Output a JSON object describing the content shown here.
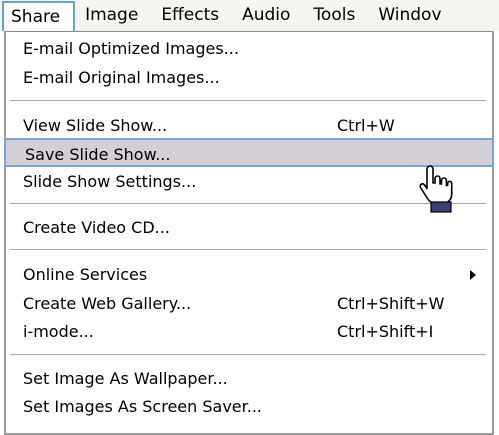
{
  "menubar": {
    "items": [
      "Share",
      "Image",
      "Effects",
      "Audio",
      "Tools",
      "Windov"
    ]
  },
  "menu": {
    "items": [
      {
        "label": "E-mail Optimized Images...",
        "shortcut": ""
      },
      {
        "label": "E-mail Original Images...",
        "shortcut": ""
      },
      {
        "label": "View Slide Show...",
        "shortcut": "Ctrl+W"
      },
      {
        "label": "Save Slide Show...",
        "shortcut": ""
      },
      {
        "label": "Slide Show Settings...",
        "shortcut": ""
      },
      {
        "label": "Create Video CD...",
        "shortcut": ""
      },
      {
        "label": "Online Services",
        "shortcut": ""
      },
      {
        "label": "Create Web Gallery...",
        "shortcut": "Ctrl+Shift+W"
      },
      {
        "label": "i-mode...",
        "shortcut": "Ctrl+Shift+I"
      },
      {
        "label": "Set Image As Wallpaper...",
        "shortcut": ""
      },
      {
        "label": "Set Images As Screen Saver...",
        "shortcut": ""
      }
    ]
  },
  "colors": {
    "highlight_bg": "#d4cfd6",
    "highlight_border": "#7aa6d6"
  },
  "icons": {
    "submenu": "chevron-right-icon",
    "cursor": "hand-pointer-icon"
  }
}
